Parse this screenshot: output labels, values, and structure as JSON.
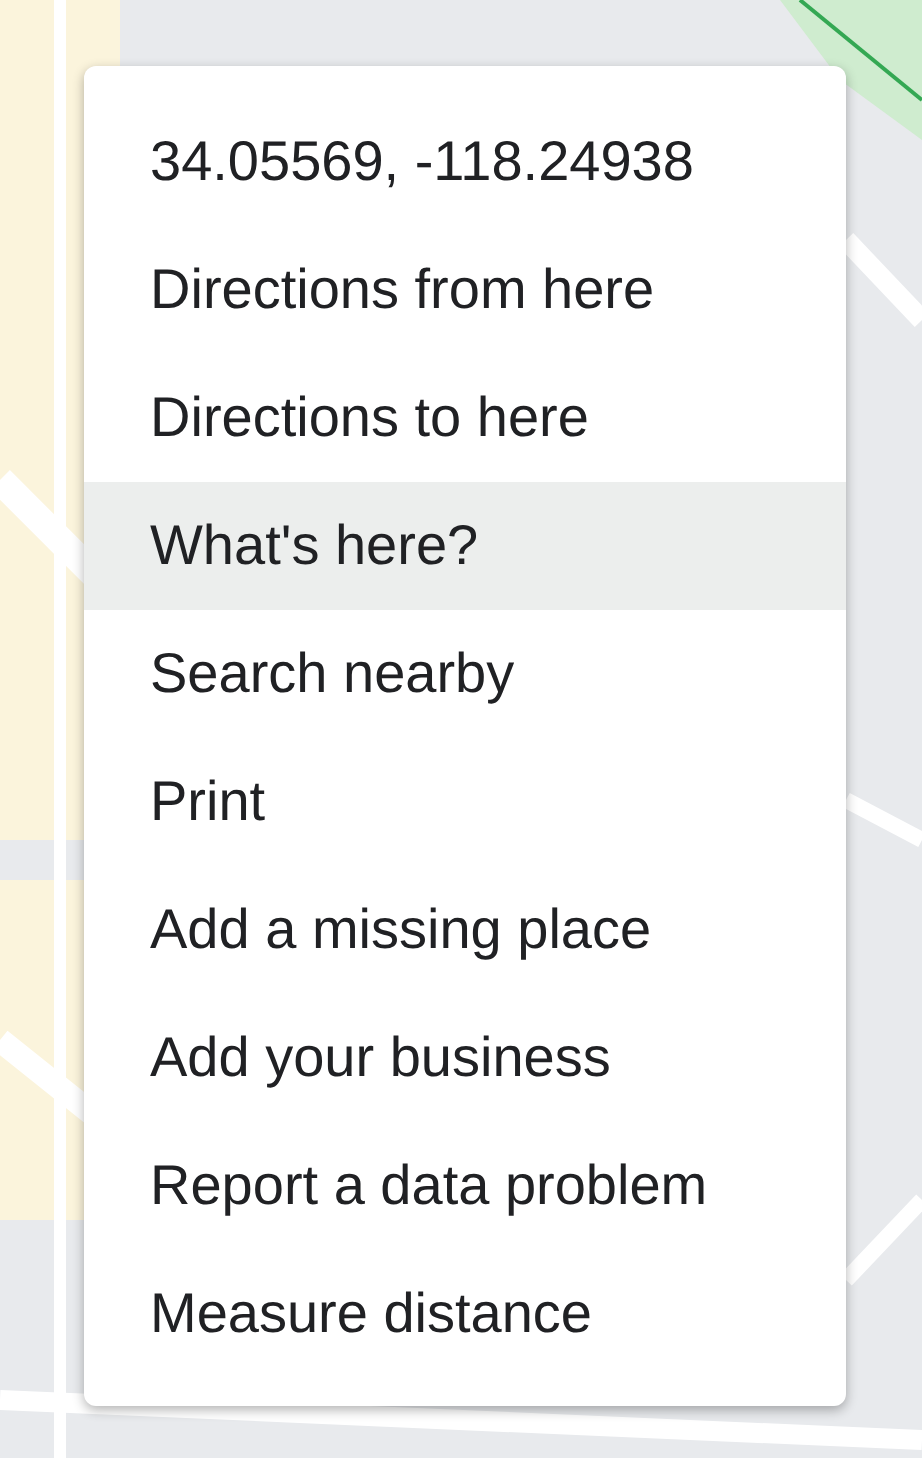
{
  "context_menu": {
    "items": [
      {
        "label": "34.05569, -118.24938",
        "selected": false
      },
      {
        "label": "Directions from here",
        "selected": false
      },
      {
        "label": "Directions to here",
        "selected": false
      },
      {
        "label": "What's here?",
        "selected": true
      },
      {
        "label": "Search nearby",
        "selected": false
      },
      {
        "label": "Print",
        "selected": false
      },
      {
        "label": "Add a missing place",
        "selected": false
      },
      {
        "label": "Add your business",
        "selected": false
      },
      {
        "label": "Report a data problem",
        "selected": false
      },
      {
        "label": "Measure distance",
        "selected": false
      }
    ]
  }
}
